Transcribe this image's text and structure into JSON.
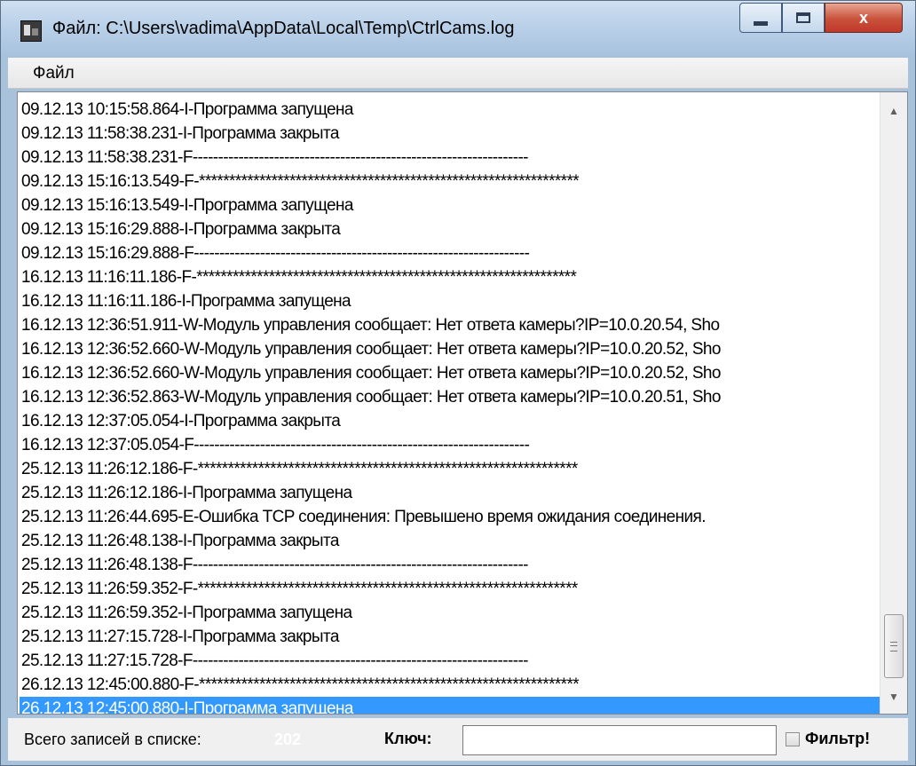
{
  "window": {
    "title": "Файл: C:\\Users\\vadima\\AppData\\Local\\Temp\\CtrlCams.log",
    "icon": "log-viewer-icon"
  },
  "caption": {
    "minimize_icon": "minimize-icon",
    "maximize_icon": "maximize-icon",
    "close_label": "x"
  },
  "menu": {
    "file_label": "Файл"
  },
  "log": {
    "lines": [
      "09.12.13 10:15:58.864-I-Программа запущена",
      "09.12.13 11:58:38.231-I-Программа закрыта",
      "09.12.13 11:58:38.231-F------------------------------------------------------------------",
      "09.12.13 15:16:13.549-F-***************************************************************",
      "09.12.13 15:16:13.549-I-Программа запущена",
      "09.12.13 15:16:29.888-I-Программа закрыта",
      "09.12.13 15:16:29.888-F------------------------------------------------------------------",
      "16.12.13 11:16:11.186-F-***************************************************************",
      "16.12.13 11:16:11.186-I-Программа запущена",
      "16.12.13 12:36:51.911-W-Модуль управления сообщает: Нет ответа камеры?IP=10.0.20.54, Sho",
      "16.12.13 12:36:52.660-W-Модуль управления сообщает: Нет ответа камеры?IP=10.0.20.52, Sho",
      "16.12.13 12:36:52.660-W-Модуль управления сообщает: Нет ответа камеры?IP=10.0.20.52, Sho",
      "16.12.13 12:36:52.863-W-Модуль управления сообщает: Нет ответа камеры?IP=10.0.20.51, Sho",
      "16.12.13 12:37:05.054-I-Программа закрыта",
      "16.12.13 12:37:05.054-F------------------------------------------------------------------",
      "25.12.13 11:26:12.186-F-***************************************************************",
      "25.12.13 11:26:12.186-I-Программа запущена",
      "25.12.13 11:26:44.695-E-Ошибка TCP соединения: Превышено время ожидания соединения.",
      "25.12.13 11:26:48.138-I-Программа закрыта",
      "25.12.13 11:26:48.138-F------------------------------------------------------------------",
      "25.12.13 11:26:59.352-F-***************************************************************",
      "25.12.13 11:26:59.352-I-Программа запущена",
      "25.12.13 11:27:15.728-I-Программа закрыта",
      "25.12.13 11:27:15.728-F------------------------------------------------------------------",
      "26.12.13 12:45:00.880-F-***************************************************************",
      "26.12.13 12:45:00.880-I-Программа запущена"
    ],
    "selected_index": 25
  },
  "status": {
    "count_label": "Всего записей в списке:",
    "count_value": "202",
    "key_label": "Ключ:",
    "key_value": "",
    "filter_label": "Фильтр!",
    "filter_checked": false
  },
  "colors": {
    "selection": "#3399ff",
    "title_bar": "#b9d0e8"
  }
}
